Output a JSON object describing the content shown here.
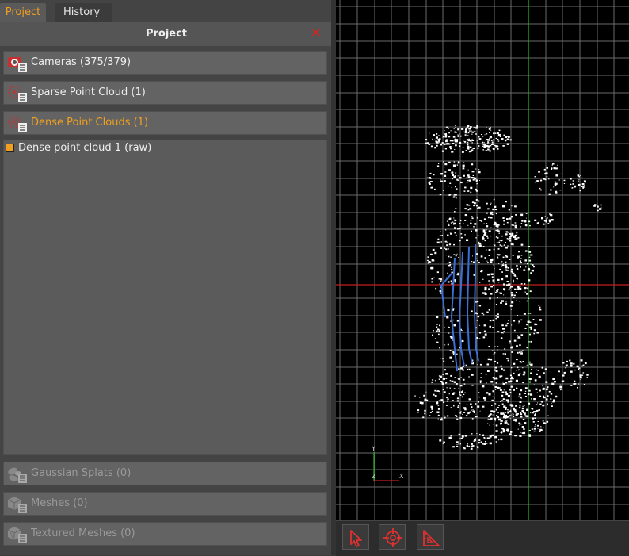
{
  "tabs": {
    "project": "Project",
    "history": "History"
  },
  "panel": {
    "title": "Project",
    "close_symbol": "✕"
  },
  "sections": {
    "cameras": "Cameras (375/379)",
    "sparse": "Sparse Point Cloud (1)",
    "dense": "Dense Point Clouds (1)",
    "gaussian": "Gaussian Splats (0)",
    "meshes": "Meshes (0)",
    "textured": "Textured Meshes (0)"
  },
  "dense_items": [
    {
      "label": "Dense point cloud 1 (raw)"
    }
  ],
  "axes": {
    "y": "Y",
    "x": "X",
    "z": "Z"
  },
  "colors": {
    "accent": "#f0a020",
    "close": "#e02020",
    "x_axis": "#c02020",
    "y_axis": "#20b020",
    "camera_path": "#3a6fd8"
  },
  "icons": {
    "cameras": "camera-icon",
    "sparse": "sparse-cloud-icon",
    "dense": "dense-cloud-icon",
    "gaussian": "gaussian-splat-icon",
    "meshes": "mesh-icon",
    "textured": "textured-mesh-icon",
    "tool_select": "select-arrow-icon",
    "tool_target": "target-crosshair-icon",
    "tool_measure": "measure-ruler-icon"
  }
}
